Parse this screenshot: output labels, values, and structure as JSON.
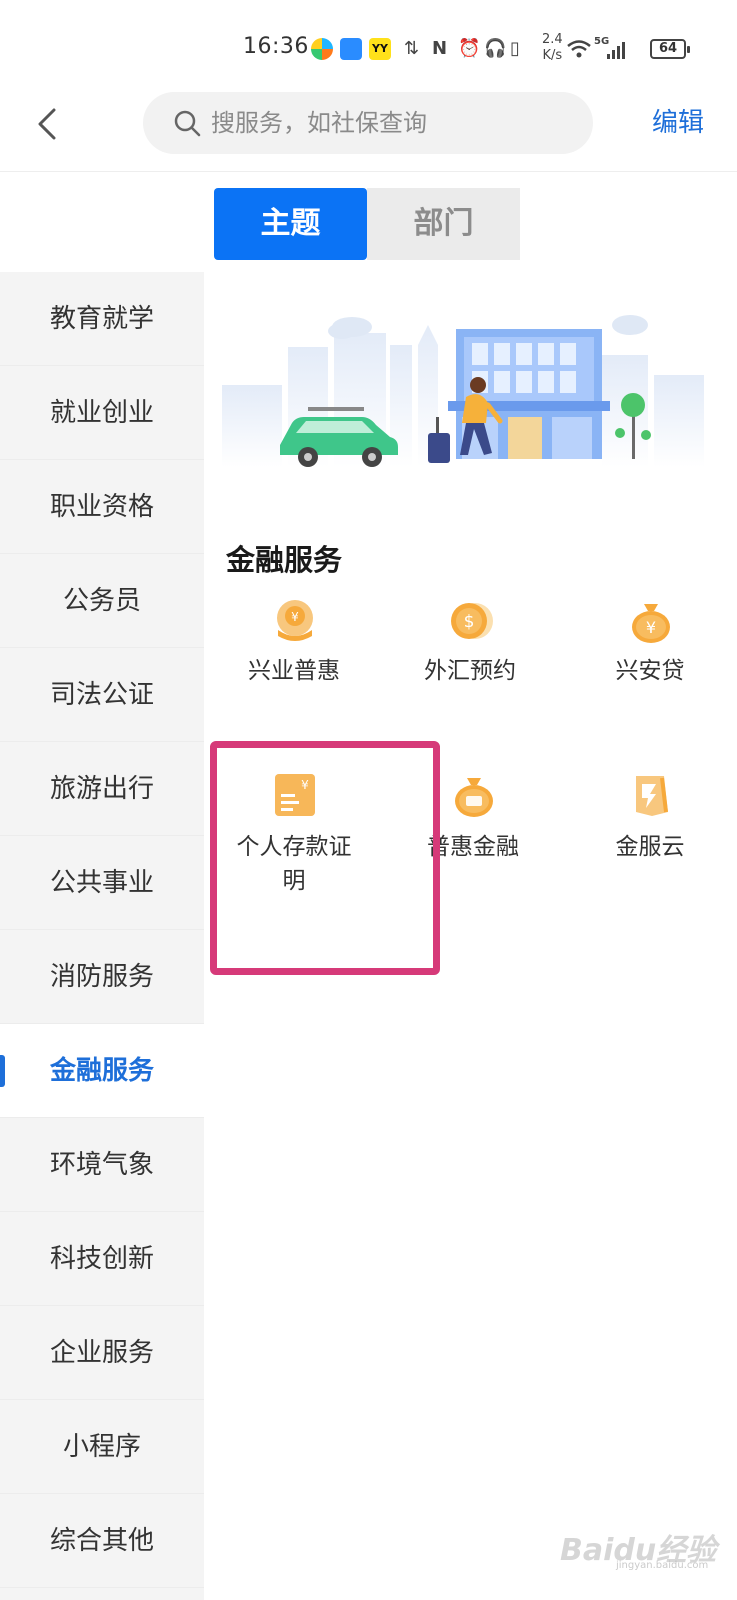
{
  "status_bar": {
    "time": "16:36",
    "app_yy": "YY",
    "network_speed_value": "2.4",
    "network_speed_unit": "K/s",
    "signal_label": "5G",
    "battery": "64"
  },
  "header": {
    "search_placeholder": "搜服务，如社保查询",
    "edit_label": "编辑"
  },
  "tabs": [
    {
      "label": "主题",
      "active": true
    },
    {
      "label": "部门",
      "active": false
    }
  ],
  "sidebar": {
    "items": [
      {
        "label": "教育就学"
      },
      {
        "label": "就业创业"
      },
      {
        "label": "职业资格"
      },
      {
        "label": "公务员"
      },
      {
        "label": "司法公证"
      },
      {
        "label": "旅游出行"
      },
      {
        "label": "公共事业"
      },
      {
        "label": "消防服务"
      },
      {
        "label": "金融服务",
        "active": true
      },
      {
        "label": "环境气象"
      },
      {
        "label": "科技创新"
      },
      {
        "label": "企业服务"
      },
      {
        "label": "小程序"
      },
      {
        "label": "综合其他"
      }
    ]
  },
  "section": {
    "title": "金融服务",
    "services": [
      {
        "label": "兴业普惠",
        "icon": "hand-coin-icon"
      },
      {
        "label": "外汇预约",
        "icon": "dollar-coin-icon"
      },
      {
        "label": "兴安贷",
        "icon": "yuan-bag-icon"
      },
      {
        "label": "个人存款证明",
        "icon": "deposit-certificate-icon",
        "line1": "个人存款证",
        "line2": "明"
      },
      {
        "label": "普惠金融",
        "icon": "pu-bag-icon"
      },
      {
        "label": "金服云",
        "icon": "cloud-shield-icon"
      }
    ]
  },
  "watermark": {
    "text": "Baidu经验",
    "sub": "jingyan.baidu.com"
  },
  "colors": {
    "accent": "#1e6fd9",
    "tab_active_bg": "#0b73f5",
    "icon_orange": "#f6a93b",
    "highlight": "#d63a79"
  }
}
